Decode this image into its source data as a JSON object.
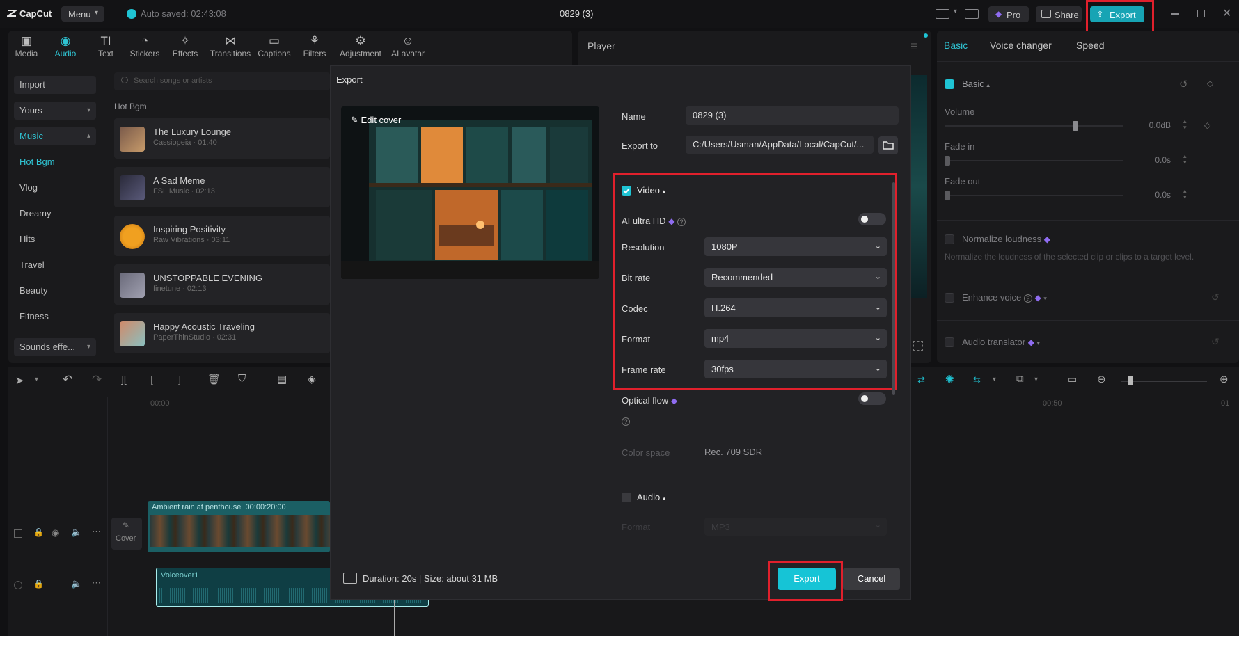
{
  "titlebar": {
    "app_name": "CapCut",
    "menu_label": "Menu",
    "autosave": "Auto saved: 02:43:08",
    "project_title": "0829 (3)",
    "pro_label": "Pro",
    "share_label": "Share",
    "export_label": "Export"
  },
  "toolbar": {
    "tabs": [
      {
        "label": "Media",
        "icon": "media-icon"
      },
      {
        "label": "Audio",
        "icon": "audio-icon"
      },
      {
        "label": "Text",
        "icon": "text-icon"
      },
      {
        "label": "Stickers",
        "icon": "stickers-icon"
      },
      {
        "label": "Effects",
        "icon": "effects-icon"
      },
      {
        "label": "Transitions",
        "icon": "transitions-icon"
      },
      {
        "label": "Captions",
        "icon": "captions-icon"
      },
      {
        "label": "Filters",
        "icon": "filters-icon"
      },
      {
        "label": "Adjustment",
        "icon": "adjustment-icon"
      },
      {
        "label": "AI avatar",
        "icon": "ai-avatar-icon"
      }
    ],
    "active_tab": "Audio"
  },
  "sidebar": {
    "import_label": "Import",
    "yours_label": "Yours",
    "music_label": "Music",
    "items": [
      "Hot Bgm",
      "Vlog",
      "Dreamy",
      "Hits",
      "Travel",
      "Beauty",
      "Fitness"
    ],
    "sounds_label": "Sounds effe..."
  },
  "library": {
    "search_placeholder": "Search songs or artists",
    "section_title": "Hot Bgm",
    "songs": [
      {
        "title": "The Luxury Lounge",
        "sub": "Cassiopeia · 01:40"
      },
      {
        "title": "A Sad Meme",
        "sub": "FSL Music · 02:13"
      },
      {
        "title": "Inspiring Positivity",
        "sub": "Raw Vibrations · 03:11"
      },
      {
        "title": "UNSTOPPABLE EVENING",
        "sub": "finetune · 02:13"
      },
      {
        "title": "Happy Acoustic Traveling",
        "sub": "PaperThinStudio · 02:31"
      }
    ]
  },
  "player": {
    "title": "Player"
  },
  "right_panel": {
    "tabs": [
      "Basic",
      "Voice changer",
      "Speed"
    ],
    "basic_section": "Basic",
    "volume_label": "Volume",
    "volume_value": "0.0dB",
    "fade_in_label": "Fade in",
    "fade_in_value": "0.0s",
    "fade_out_label": "Fade out",
    "fade_out_value": "0.0s",
    "normalize_label": "Normalize loudness",
    "normalize_desc": "Normalize the loudness of the selected clip or clips to a target level.",
    "enhance_label": "Enhance voice",
    "translator_label": "Audio translator"
  },
  "timeline": {
    "ruler_start": "00:00",
    "ruler_mid": "00:50",
    "ruler_end": "01",
    "video_clip_label": "Ambient rain at penthouse",
    "video_clip_time": "00:00:20:00",
    "audio_clip_label": "Voiceover1",
    "cover_label": "Cover"
  },
  "export_dialog": {
    "title": "Export",
    "edit_cover": "Edit cover",
    "name_label": "Name",
    "name_value": "0829 (3)",
    "export_to_label": "Export to",
    "export_to_value": "C:/Users/Usman/AppData/Local/CapCut/...",
    "video_section": "Video",
    "ai_ultra_hd": "AI ultra HD",
    "resolution_label": "Resolution",
    "resolution_value": "1080P",
    "bitrate_label": "Bit rate",
    "bitrate_value": "Recommended",
    "codec_label": "Codec",
    "codec_value": "H.264",
    "format_label": "Format",
    "format_value": "mp4",
    "framerate_label": "Frame rate",
    "framerate_value": "30fps",
    "optical_flow": "Optical flow",
    "color_space_label": "Color space",
    "color_space_value": "Rec. 709 SDR",
    "audio_section": "Audio",
    "audio_format_label": "Format",
    "audio_format_value": "MP3",
    "footer_info": "Duration: 20s | Size: about 31 MB",
    "export_button": "Export",
    "cancel_button": "Cancel"
  },
  "colors": {
    "accent": "#1fc4d4",
    "highlight": "#e0202c",
    "background": "#111113"
  }
}
